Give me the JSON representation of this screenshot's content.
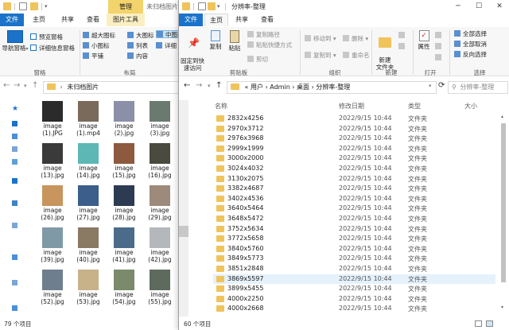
{
  "left": {
    "title_tab": "管理",
    "title_text": "未归档图片",
    "tabs": [
      "文件",
      "主页",
      "共享",
      "查看",
      "图片工具"
    ],
    "ribbon": {
      "nav_pane": "导航窗格",
      "preview_pane": "预览窗格",
      "details_pane": "详细信息窗格",
      "extra_large": "超大图标",
      "large": "大图标",
      "medium": "中图标",
      "small": "小图标",
      "list": "列表",
      "details": "详细",
      "tiles": "平铺",
      "content": "内容",
      "group_panes": "窗格",
      "group_layout": "布局"
    },
    "address_path": "未归档图片",
    "files": [
      {
        "name": "image",
        "ext": "(1).JPG",
        "color": "#2b2b2b"
      },
      {
        "name": "image",
        "ext": "(1).mp4",
        "color": "#7a6a5c"
      },
      {
        "name": "image",
        "ext": "(2).jpg",
        "color": "#8b8fa8"
      },
      {
        "name": "image",
        "ext": "(3).jpg",
        "color": "#6a7a6e"
      },
      {
        "name": "image",
        "ext": "(13).jpg",
        "color": "#3a3a3a"
      },
      {
        "name": "image",
        "ext": "(14).jpg",
        "color": "#5db7b5"
      },
      {
        "name": "image",
        "ext": "(15).jpg",
        "color": "#8d5a3f"
      },
      {
        "name": "image",
        "ext": "(16).jpg",
        "color": "#4a4a3e"
      },
      {
        "name": "image",
        "ext": "(26).jpg",
        "color": "#c7955d"
      },
      {
        "name": "image",
        "ext": "(27).jpg",
        "color": "#3b5e8a"
      },
      {
        "name": "image",
        "ext": "(28).jpg",
        "color": "#2c3b52"
      },
      {
        "name": "image",
        "ext": "(29).jpg",
        "color": "#9e8a7a"
      },
      {
        "name": "image",
        "ext": "(39).jpg",
        "color": "#7f9aa6"
      },
      {
        "name": "image",
        "ext": "(40).jpg",
        "color": "#8a7a63"
      },
      {
        "name": "image",
        "ext": "(41).jpg",
        "color": "#4a6b8a"
      },
      {
        "name": "image",
        "ext": "(42).jpg",
        "color": "#b4b8bc"
      },
      {
        "name": "image",
        "ext": "(52).jpg",
        "color": "#6e7e8e"
      },
      {
        "name": "image",
        "ext": "(53).jpg",
        "color": "#c8b28a"
      },
      {
        "name": "image",
        "ext": "(54).jpg",
        "color": "#7a8a6a"
      },
      {
        "name": "image",
        "ext": "(55).jpg",
        "color": "#5e6a5e"
      }
    ],
    "status": "79 个项目"
  },
  "right": {
    "title_text": "分辨率-整理",
    "tabs": [
      "文件",
      "主页",
      "共享",
      "查看"
    ],
    "ribbon": {
      "pin": "固定到快\n速访问",
      "copy": "复制",
      "paste": "粘贴",
      "copy_path": "复制路径",
      "paste_shortcut": "粘贴快捷方式",
      "cut": "剪切",
      "group_clipboard": "剪贴板",
      "move_to": "移动到",
      "copy_to": "复制到",
      "delete": "删除",
      "rename": "重命名",
      "group_organize": "组织",
      "new_folder": "新建\n文件夹",
      "group_new": "新建",
      "properties": "属性",
      "group_open": "打开",
      "select_all": "全部选择",
      "select_none": "全部取消",
      "invert_selection": "反向选择",
      "group_select": "选择"
    },
    "address_path": "«  用户  ›  Admin  ›  桌面  ›  分辨率-整理",
    "columns": {
      "name": "名称",
      "date": "修改日期",
      "type": "类型",
      "size": "大小"
    },
    "rows": [
      {
        "name": "2832x4256",
        "date": "2022/9/15 10:44",
        "type": "文件夹"
      },
      {
        "name": "2970x3712",
        "date": "2022/9/15 10:44",
        "type": "文件夹"
      },
      {
        "name": "2976x3968",
        "date": "2022/9/15 10:44",
        "type": "文件夹"
      },
      {
        "name": "2999x1999",
        "date": "2022/9/15 10:44",
        "type": "文件夹"
      },
      {
        "name": "3000x2000",
        "date": "2022/9/15 10:44",
        "type": "文件夹"
      },
      {
        "name": "3024x4032",
        "date": "2022/9/15 10:44",
        "type": "文件夹"
      },
      {
        "name": "3130x2075",
        "date": "2022/9/15 10:44",
        "type": "文件夹"
      },
      {
        "name": "3382x4687",
        "date": "2022/9/15 10:44",
        "type": "文件夹"
      },
      {
        "name": "3402x4536",
        "date": "2022/9/15 10:44",
        "type": "文件夹"
      },
      {
        "name": "3640x5464",
        "date": "2022/9/15 10:44",
        "type": "文件夹"
      },
      {
        "name": "3648x5472",
        "date": "2022/9/15 10:44",
        "type": "文件夹"
      },
      {
        "name": "3752x5634",
        "date": "2022/9/15 10:44",
        "type": "文件夹"
      },
      {
        "name": "3772x5658",
        "date": "2022/9/15 10:44",
        "type": "文件夹"
      },
      {
        "name": "3840x5760",
        "date": "2022/9/15 10:44",
        "type": "文件夹"
      },
      {
        "name": "3849x5773",
        "date": "2022/9/15 10:44",
        "type": "文件夹"
      },
      {
        "name": "3851x2848",
        "date": "2022/9/15 10:44",
        "type": "文件夹"
      },
      {
        "name": "3869x5597",
        "date": "2022/9/15 10:44",
        "type": "文件夹",
        "selected": true
      },
      {
        "name": "3899x5455",
        "date": "2022/9/15 10:44",
        "type": "文件夹"
      },
      {
        "name": "4000x2250",
        "date": "2022/9/15 10:44",
        "type": "文件夹"
      },
      {
        "name": "4000x2668",
        "date": "2022/9/15 10:44",
        "type": "文件夹"
      }
    ],
    "status": "60 个项目"
  }
}
